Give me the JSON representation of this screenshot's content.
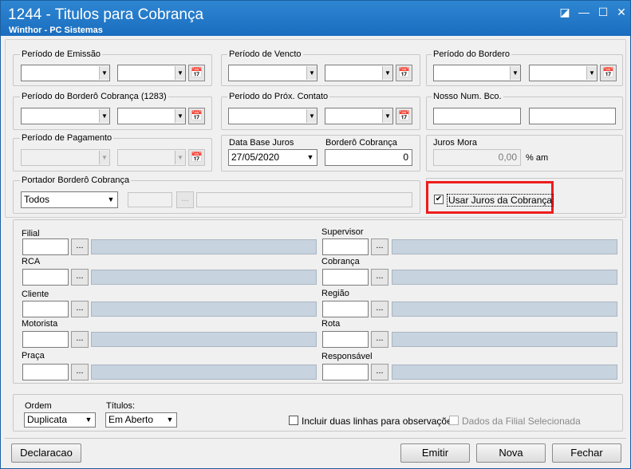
{
  "window": {
    "title": "1244 - Titulos para Cobrança",
    "subtitle": "Winthor - PC Sistemas",
    "controls": [
      "◪",
      "—",
      "☐",
      "✕"
    ]
  },
  "periodo_emissao": {
    "label": "Período de Emissão"
  },
  "periodo_vencto": {
    "label": "Período de Vencto"
  },
  "periodo_bordero": {
    "label": "Período do Bordero"
  },
  "periodo_bordero_cobranca": {
    "label": "Período do Borderô Cobrança (1283)"
  },
  "periodo_prox_contato": {
    "label": "Período do Próx. Contato"
  },
  "nosso_num": {
    "label": "Nosso Num. Bco."
  },
  "periodo_pagamento": {
    "label": "Período de Pagamento"
  },
  "data_base_juros": {
    "label": "Data Base Juros",
    "value": "27/05/2020"
  },
  "bordero_cobranca": {
    "label": "Borderô Cobrança",
    "value": "0"
  },
  "juros_mora": {
    "label": "Juros Mora",
    "value": "0,00",
    "unit": "% am"
  },
  "portador": {
    "label": "Portador Borderô Cobrança",
    "value": "Todos",
    "dots": "..."
  },
  "usar_juros": {
    "label": "Usar Juros da Cobrança",
    "checked": "✔"
  },
  "filters_left": [
    {
      "label": "Filial"
    },
    {
      "label": "RCA"
    },
    {
      "label": "Cliente"
    },
    {
      "label": "Motorista"
    },
    {
      "label": "Praça"
    }
  ],
  "filters_right": [
    {
      "label": "Supervisor"
    },
    {
      "label": "Cobrança"
    },
    {
      "label": "Região"
    },
    {
      "label": "Rota"
    },
    {
      "label": "Responsável"
    }
  ],
  "dots_label": "...",
  "ordem": {
    "label": "Ordem",
    "value": "Duplicata"
  },
  "titulos": {
    "label": "Títulos:",
    "value": "Em Aberto"
  },
  "incluir_duas_linhas": {
    "label": "Incluir duas linhas para observações"
  },
  "dados_filial": {
    "label": "Dados da Filial Selecionada"
  },
  "buttons": {
    "declaracao": "Declaracao",
    "emitir": "Emitir",
    "nova": "Nova",
    "fechar": "Fechar"
  },
  "icons": {
    "dropdown": "▼",
    "calendar": "📅"
  },
  "colors": {
    "titlebar": "#1a6dbf",
    "highlight": "#ee1c1c",
    "disabled_field": "#c7d3de"
  }
}
